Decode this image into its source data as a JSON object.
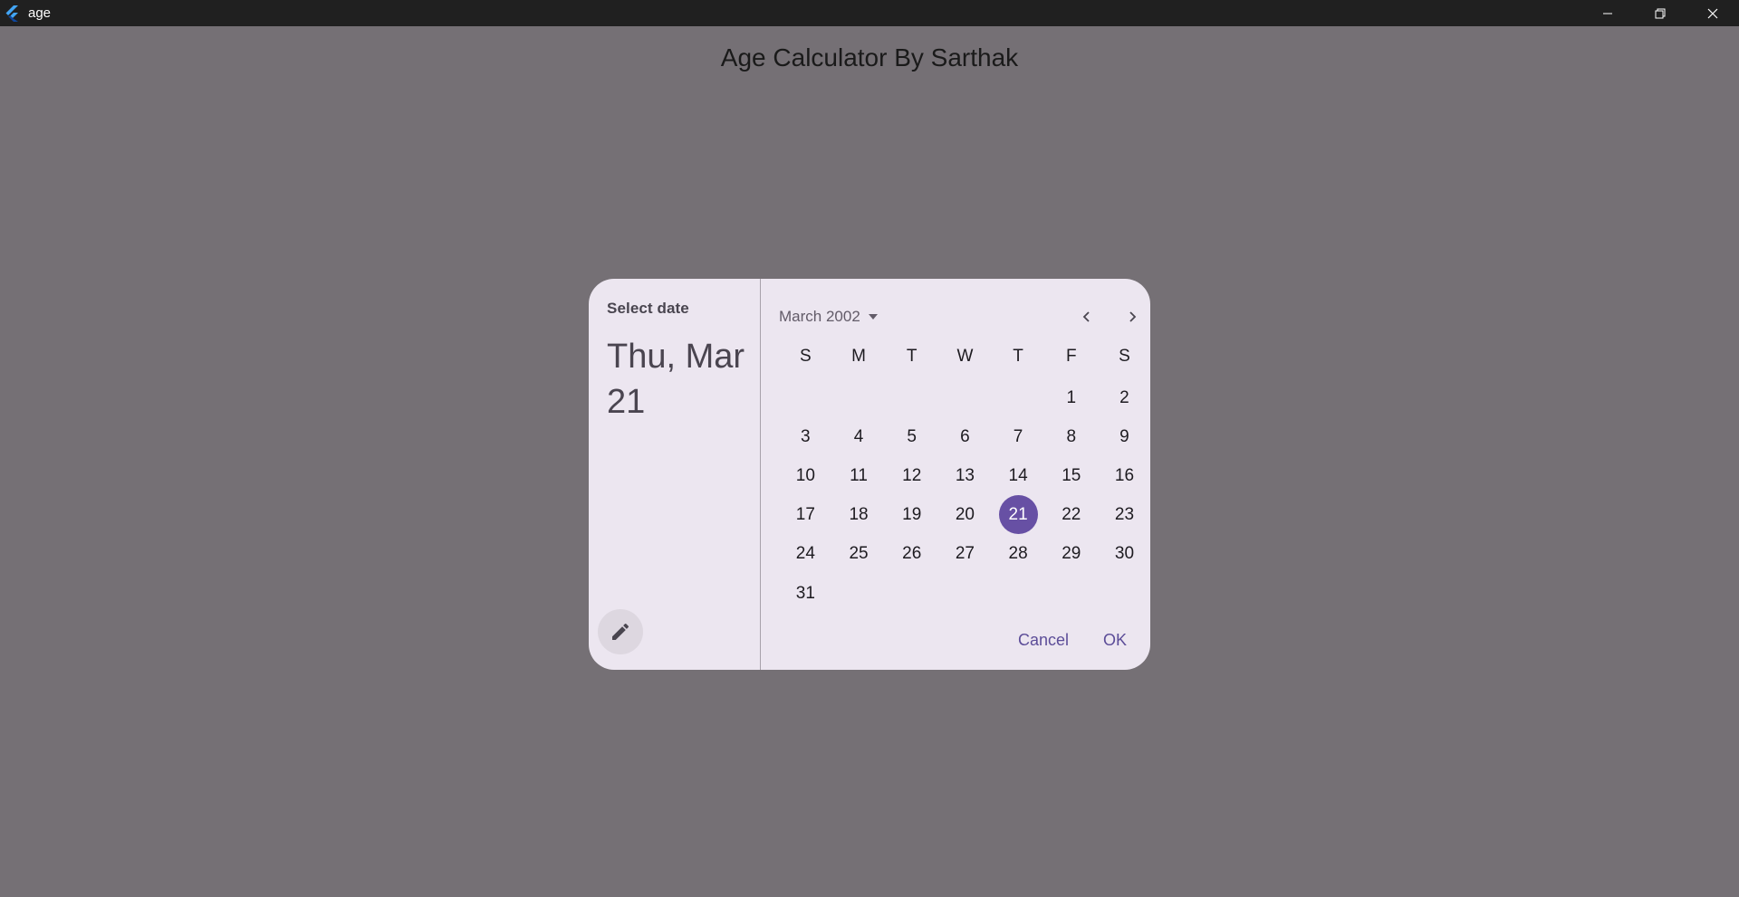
{
  "window": {
    "title": "age",
    "icon": "flutter-logo-icon",
    "controls": [
      "minimize-icon",
      "restore-icon",
      "close-icon"
    ]
  },
  "app": {
    "heading": "Age Calculator By Sarthak"
  },
  "date_picker": {
    "help_text": "Select date",
    "headline": "Thu, Mar 21",
    "edit_icon": "pencil-icon",
    "month_label": "March 2002",
    "dropdown_icon": "triangle-down-icon",
    "prev_icon": "chevron-left-icon",
    "next_icon": "chevron-right-icon",
    "weekdays": [
      "S",
      "M",
      "T",
      "W",
      "T",
      "F",
      "S"
    ],
    "weeks": [
      [
        "",
        "",
        "",
        "",
        "",
        "1",
        "2"
      ],
      [
        "3",
        "4",
        "5",
        "6",
        "7",
        "8",
        "9"
      ],
      [
        "10",
        "11",
        "12",
        "13",
        "14",
        "15",
        "16"
      ],
      [
        "17",
        "18",
        "19",
        "20",
        "21",
        "22",
        "23"
      ],
      [
        "24",
        "25",
        "26",
        "27",
        "28",
        "29",
        "30"
      ],
      [
        "31",
        "",
        "",
        "",
        "",
        "",
        ""
      ]
    ],
    "selected_day": "21",
    "cancel_label": "Cancel",
    "ok_label": "OK",
    "colors": {
      "surface": "#ece6f0",
      "primary": "#6750a4",
      "scrim_background": "#757075"
    }
  }
}
